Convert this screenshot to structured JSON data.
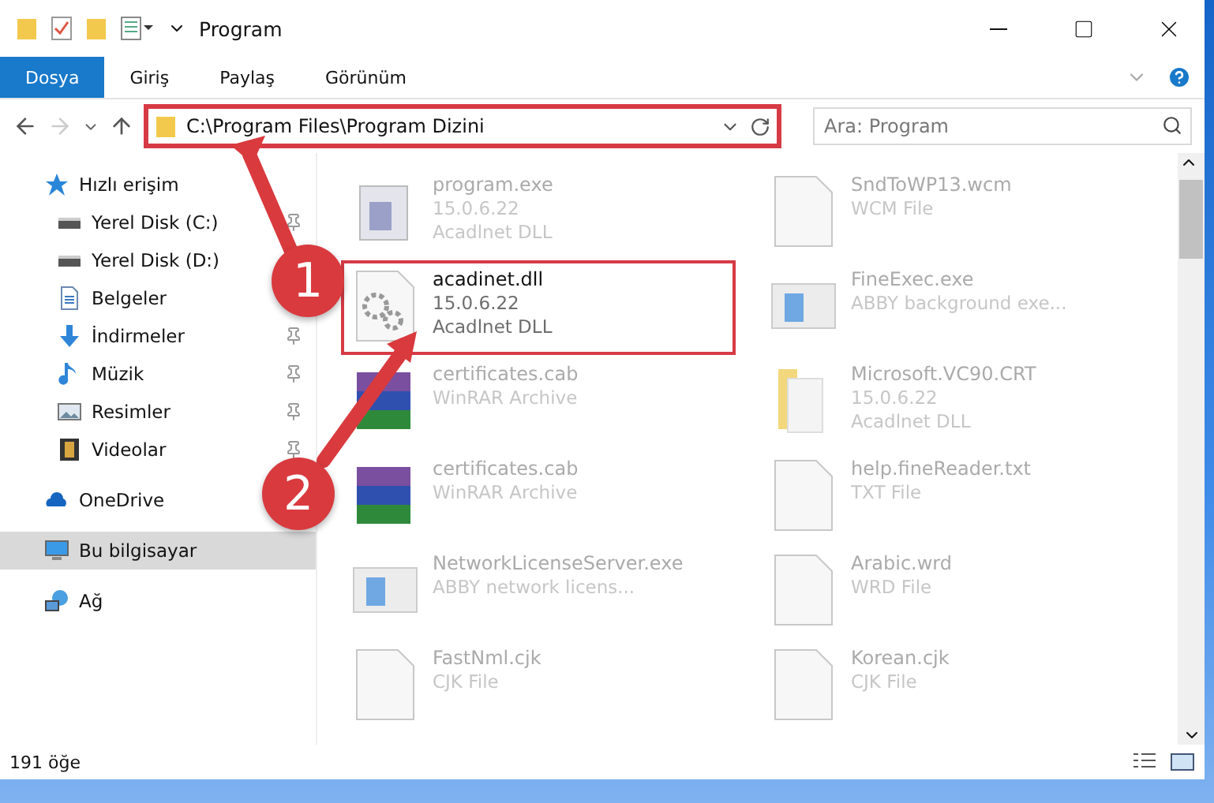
{
  "window": {
    "title": "Program"
  },
  "ribbon_tabs": [
    {
      "label": "Dosya",
      "selected": true
    },
    {
      "label": "Giriş",
      "selected": false
    },
    {
      "label": "Paylaş",
      "selected": false
    },
    {
      "label": "Görünüm",
      "selected": false
    }
  ],
  "address": {
    "path": "C:\\Program Files\\Program Dizini",
    "highlighted": true
  },
  "search": {
    "placeholder": "Ara: Program"
  },
  "sidebar": {
    "items": [
      {
        "label": "Hızlı erişim",
        "kind": "star",
        "selected": false,
        "children": [
          {
            "label": "Yerel Disk (C:)",
            "kind": "drive",
            "pinned": true,
            "selected": false
          },
          {
            "label": "Yerel Disk (D:)",
            "kind": "drive",
            "selected": false
          },
          {
            "label": "Belgeler",
            "kind": "doc",
            "selected": false
          },
          {
            "label": "İndirmeler",
            "kind": "download",
            "pinned": true,
            "selected": false
          },
          {
            "label": "Müzik",
            "kind": "music",
            "pinned": true,
            "selected": false
          },
          {
            "label": "Resimler",
            "kind": "picture",
            "pinned": true,
            "selected": false
          },
          {
            "label": "Videolar",
            "kind": "video",
            "pinned": true,
            "selected": false
          }
        ]
      },
      {
        "label": "OneDrive",
        "kind": "cloud",
        "selected": false
      },
      {
        "label": "Bu bilgisayar",
        "kind": "pc",
        "selected": true
      },
      {
        "label": "Ağ",
        "kind": "network",
        "selected": false
      }
    ]
  },
  "files": [
    {
      "name": "program.exe",
      "details": [
        "15.0.6.22",
        "Acadlnet DLL"
      ],
      "kind": "app",
      "highlighted": false,
      "blurred": true
    },
    {
      "name": "SndToWP13.wcm",
      "details": [
        "WCM File"
      ],
      "kind": "file",
      "highlighted": false,
      "blurred": true
    },
    {
      "name": "acadinet.dll",
      "details": [
        "15.0.6.22",
        "Acadlnet DLL"
      ],
      "kind": "dll",
      "highlighted": true,
      "blurred": false
    },
    {
      "name": "FineExec.exe",
      "details": [
        "ABBY background exe..."
      ],
      "kind": "window",
      "highlighted": false,
      "blurred": true
    },
    {
      "name": "certificates.cab",
      "details": [
        "WinRAR Archive"
      ],
      "kind": "cab",
      "highlighted": false,
      "blurred": true
    },
    {
      "name": "Microsoft.VC90.CRT",
      "details": [
        "15.0.6.22",
        "Acadlnet DLL"
      ],
      "kind": "folder",
      "highlighted": false,
      "blurred": true
    },
    {
      "name": "certificates.cab",
      "details": [
        "WinRAR Archive"
      ],
      "kind": "cab",
      "highlighted": false,
      "blurred": true
    },
    {
      "name": "help.fineReader.txt",
      "details": [
        "TXT File"
      ],
      "kind": "file",
      "highlighted": false,
      "blurred": true
    },
    {
      "name": "NetworkLicenseServer.exe",
      "details": [
        "ABBY network licens..."
      ],
      "kind": "window",
      "highlighted": false,
      "blurred": true
    },
    {
      "name": "Arabic.wrd",
      "details": [
        "WRD File"
      ],
      "kind": "file",
      "highlighted": false,
      "blurred": true
    },
    {
      "name": "FastNml.cjk",
      "details": [
        "CJK File"
      ],
      "kind": "file",
      "highlighted": false,
      "blurred": true
    },
    {
      "name": "Korean.cjk",
      "details": [
        "CJK File"
      ],
      "kind": "file",
      "highlighted": false,
      "blurred": true
    }
  ],
  "status_bar": {
    "count": "191 öğe"
  },
  "annotations": [
    {
      "label": "1"
    },
    {
      "label": "2"
    }
  ]
}
